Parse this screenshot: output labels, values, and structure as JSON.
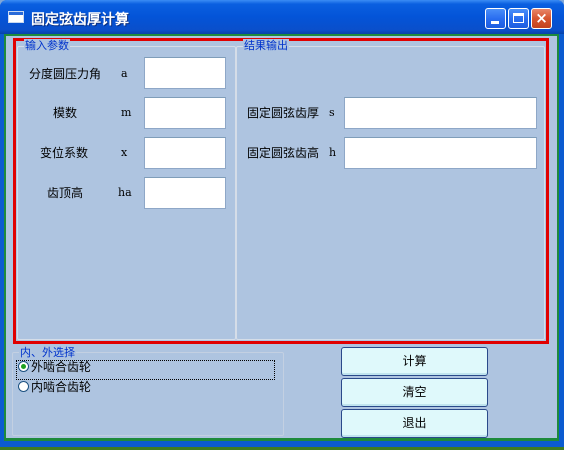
{
  "window": {
    "title": "固定弦齿厚计算",
    "buttons": {
      "minimize": "minimize",
      "maximize": "maximize",
      "close": "×"
    }
  },
  "input_group": {
    "title": "输入参数",
    "fields": [
      {
        "label": "分度圆压力角",
        "symbol": "a",
        "value": ""
      },
      {
        "label": "模数",
        "symbol": "m",
        "value": ""
      },
      {
        "label": "变位系数",
        "symbol": "x",
        "value": ""
      },
      {
        "label": "齿顶高",
        "symbol": "ha",
        "value": ""
      }
    ]
  },
  "output_group": {
    "title": "结果输出",
    "fields": [
      {
        "label": "固定圆弦齿厚",
        "symbol": "s",
        "value": ""
      },
      {
        "label": "固定圆弦齿高",
        "symbol": "h",
        "value": ""
      }
    ]
  },
  "mesh_group": {
    "title": "内、外选择",
    "options": [
      {
        "label": "外啮合齿轮",
        "checked": true
      },
      {
        "label": "内啮合齿轮",
        "checked": false
      }
    ]
  },
  "actions": {
    "calculate": "计算",
    "clear": "清空",
    "exit": "退出"
  },
  "colors": {
    "title_bar": "#0454d8",
    "client_bg": "#aec4e0",
    "highlight_frame": "#e00000",
    "group_label": "#0033cc",
    "button_bg": "#dff9fb",
    "border_green": "#1e8a3c"
  }
}
